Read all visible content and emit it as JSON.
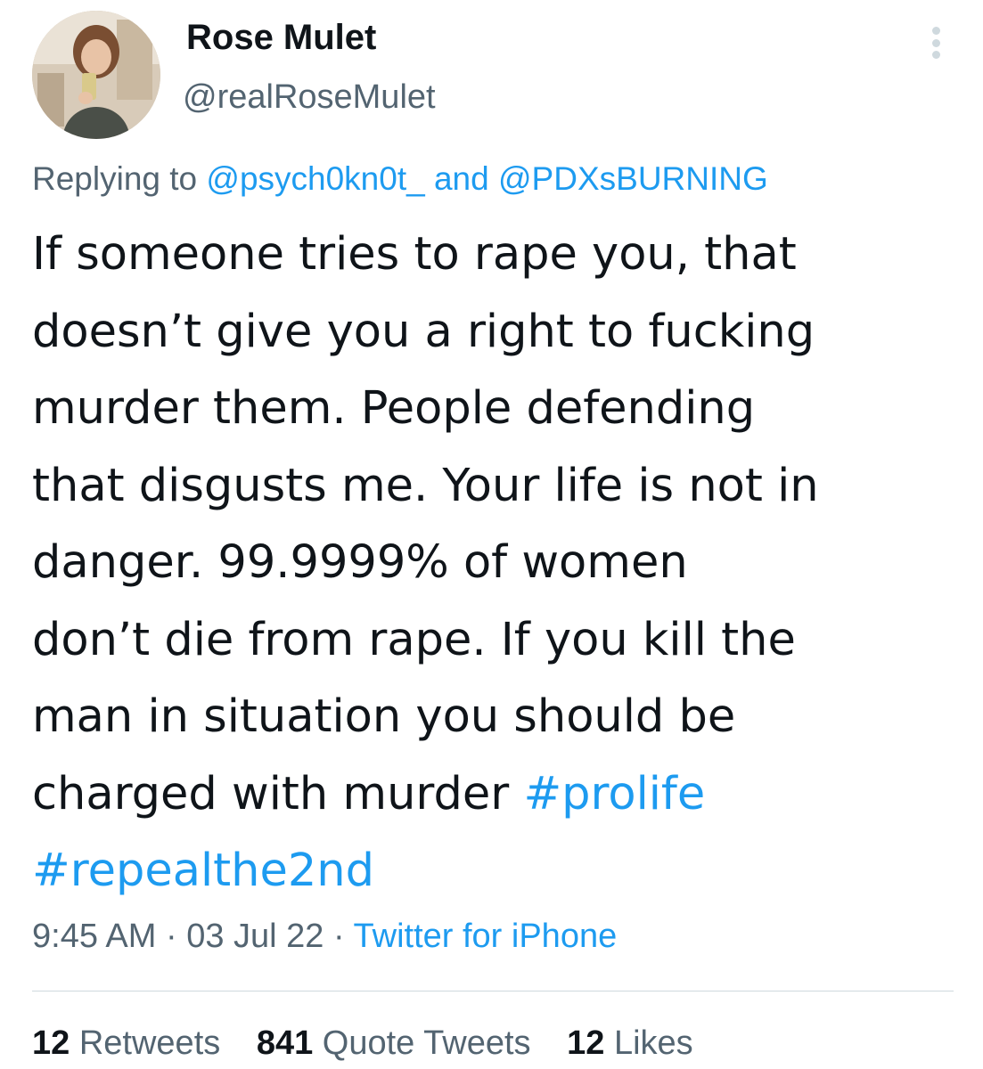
{
  "author": {
    "display_name": "Rose Mulet",
    "handle": "@realRoseMulet",
    "avatar_icon": "profile-photo"
  },
  "reply": {
    "prefix": "Replying to ",
    "mention_1": "@psych0kn0t_",
    "joiner": " and ",
    "mention_2": "@PDXsBURNING"
  },
  "tweet": {
    "lines": [
      "If someone tries to rape you, that",
      "doesn’t give you a right to fucking",
      "murder them. People defending",
      "that disgusts me. Your life is not in",
      "danger. 99.9999% of women",
      "don’t die from rape. If you kill the",
      "man in situation you should be",
      "charged with murder "
    ],
    "hashtag_1": "#prolife",
    "hashtag_2": "#repealthe2nd"
  },
  "meta": {
    "time": "9:45 AM",
    "separator": " · ",
    "date": "03 Jul 22",
    "source": "Twitter for iPhone"
  },
  "stats": {
    "retweets_count": "12",
    "retweets_label": "Retweets",
    "quotes_count": "841",
    "quotes_label": "Quote Tweets",
    "likes_count": "12",
    "likes_label": "Likes"
  },
  "colors": {
    "link": "#1d9bf0",
    "secondary_text": "#536471",
    "primary_text": "#0f1419"
  }
}
